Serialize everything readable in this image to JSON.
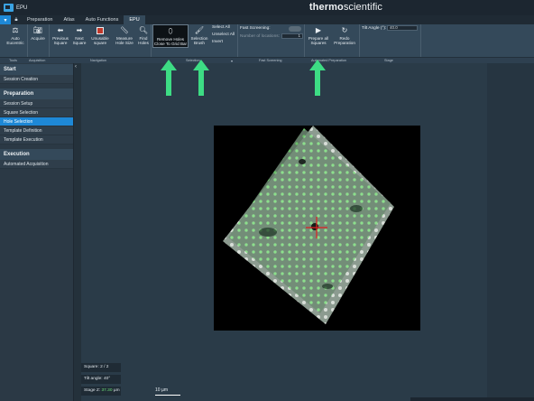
{
  "window": {
    "title": "EPU"
  },
  "tabs": [
    {
      "label": "Preparation"
    },
    {
      "label": "Atlas"
    },
    {
      "label": "Auto Functions"
    },
    {
      "label": "EPU"
    }
  ],
  "brand": {
    "part1": "thermo",
    "part2": "scientific"
  },
  "ribbon": {
    "auto_eucentric": "Auto\nEucentric",
    "acquire": "Acquire",
    "previous_square": "Previous\nSquare",
    "next_square": "Next\nSquare",
    "unusable_square": "Unusable\nsquare",
    "measure_hole_size": "Measure\nHole Size",
    "find_holes": "Find\nHoles",
    "remove_holes": "Remove Holes\nClose To Grid Bar",
    "selection_brush": "Selection\nBrush",
    "select_all": "Select All",
    "unselect_all": "Unselect All",
    "invert": "Invert",
    "fast_screening": "Fast Screening:",
    "number_of_locations": "Number of locations:",
    "number_of_locations_value": "1",
    "prepare_all_squares": "Prepare all\nSquares",
    "redo_preparation": "Redo\nPreparation",
    "tilt_angle_label": "Tilt Angle (°):",
    "tilt_angle_value": "40.0",
    "groups": {
      "tools": "Tools",
      "acquisition": "Acquisition",
      "navigation": "Navigation",
      "selection": "Selection",
      "fast_screening": "Fast Screening",
      "automated_preparation": "Automated Preparation",
      "stage": "Stage"
    }
  },
  "sidebar": {
    "start_header": "Start",
    "session_creation": "Session Creation",
    "preparation_header": "Preparation",
    "session_setup": "Session Setup",
    "square_selection": "Square Selection",
    "hole_selection": "Hole Selection",
    "template_definition": "Template Definition",
    "template_execution": "Template Execution",
    "execution_header": "Execution",
    "automated_acquisition": "Automated Acquisition"
  },
  "overlay": {
    "square": "Square: 2 / 2",
    "tilt_angle": "Tilt angle: 40°",
    "stage_z_label": "Stage Z:",
    "stage_z_value": "37.30",
    "stage_z_unit": "µm",
    "scale_bar": "10 µm"
  },
  "colors": {
    "accent": "#1e88d6",
    "arrow": "#3ddc84",
    "crosshair": "#e02020",
    "hole_selected": "#7de07d"
  }
}
